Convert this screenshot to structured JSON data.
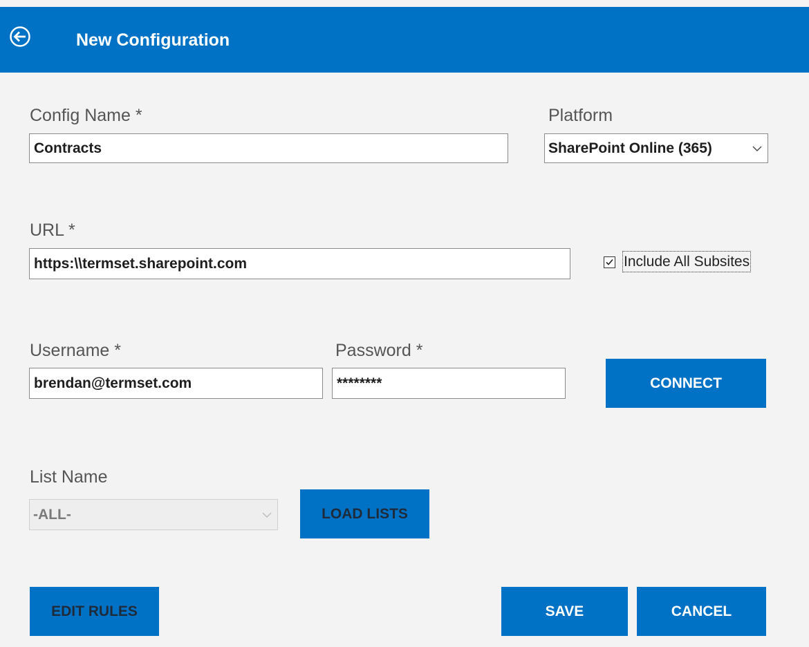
{
  "header": {
    "title": "New Configuration",
    "back_icon": "arrow-left-circle-icon",
    "background_color": "#0072c6"
  },
  "config_name": {
    "label": "Config Name *",
    "value": "Contracts"
  },
  "platform": {
    "label": "Platform",
    "selected": "SharePoint Online (365)",
    "icon": "chevron-down-icon"
  },
  "url": {
    "label": "URL *",
    "value": "https:\\\\termset.sharepoint.com"
  },
  "include_subsites": {
    "label": "Include All Subsites",
    "checked": true
  },
  "username": {
    "label": "Username *",
    "value": "brendan@termset.com"
  },
  "password": {
    "label": "Password *",
    "value": "********"
  },
  "connect_button": {
    "label": "CONNECT"
  },
  "list_name": {
    "label": "List Name",
    "selected": "-ALL-",
    "disabled": true
  },
  "load_lists_button": {
    "label": "LOAD LISTS"
  },
  "edit_rules_button": {
    "label": "EDIT RULES"
  },
  "save_button": {
    "label": "SAVE"
  },
  "cancel_button": {
    "label": "CANCEL"
  }
}
